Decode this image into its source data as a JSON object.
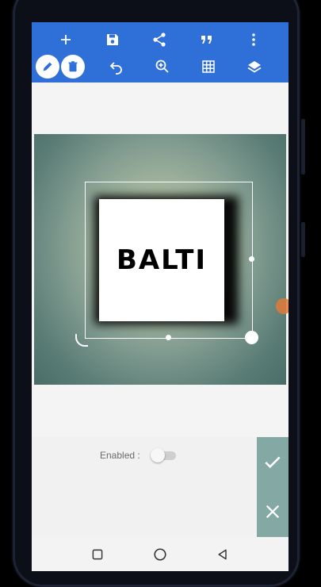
{
  "toolbar": {
    "row1": [
      "add-icon",
      "save-icon",
      "share-icon",
      "quote-icon",
      "more-vert-icon"
    ],
    "row2": [
      "pencil-icon",
      "trash-icon",
      "undo-icon",
      "zoom-in-icon",
      "grid-icon",
      "layers-icon"
    ],
    "color": "#2f6fd8"
  },
  "canvas": {
    "text": "BALTI"
  },
  "panel": {
    "enabled_label": "Enabled :",
    "enabled_value": false,
    "accent": "#84a8a4"
  },
  "navbar": [
    "square-icon",
    "circle-icon",
    "back-triangle-icon"
  ]
}
